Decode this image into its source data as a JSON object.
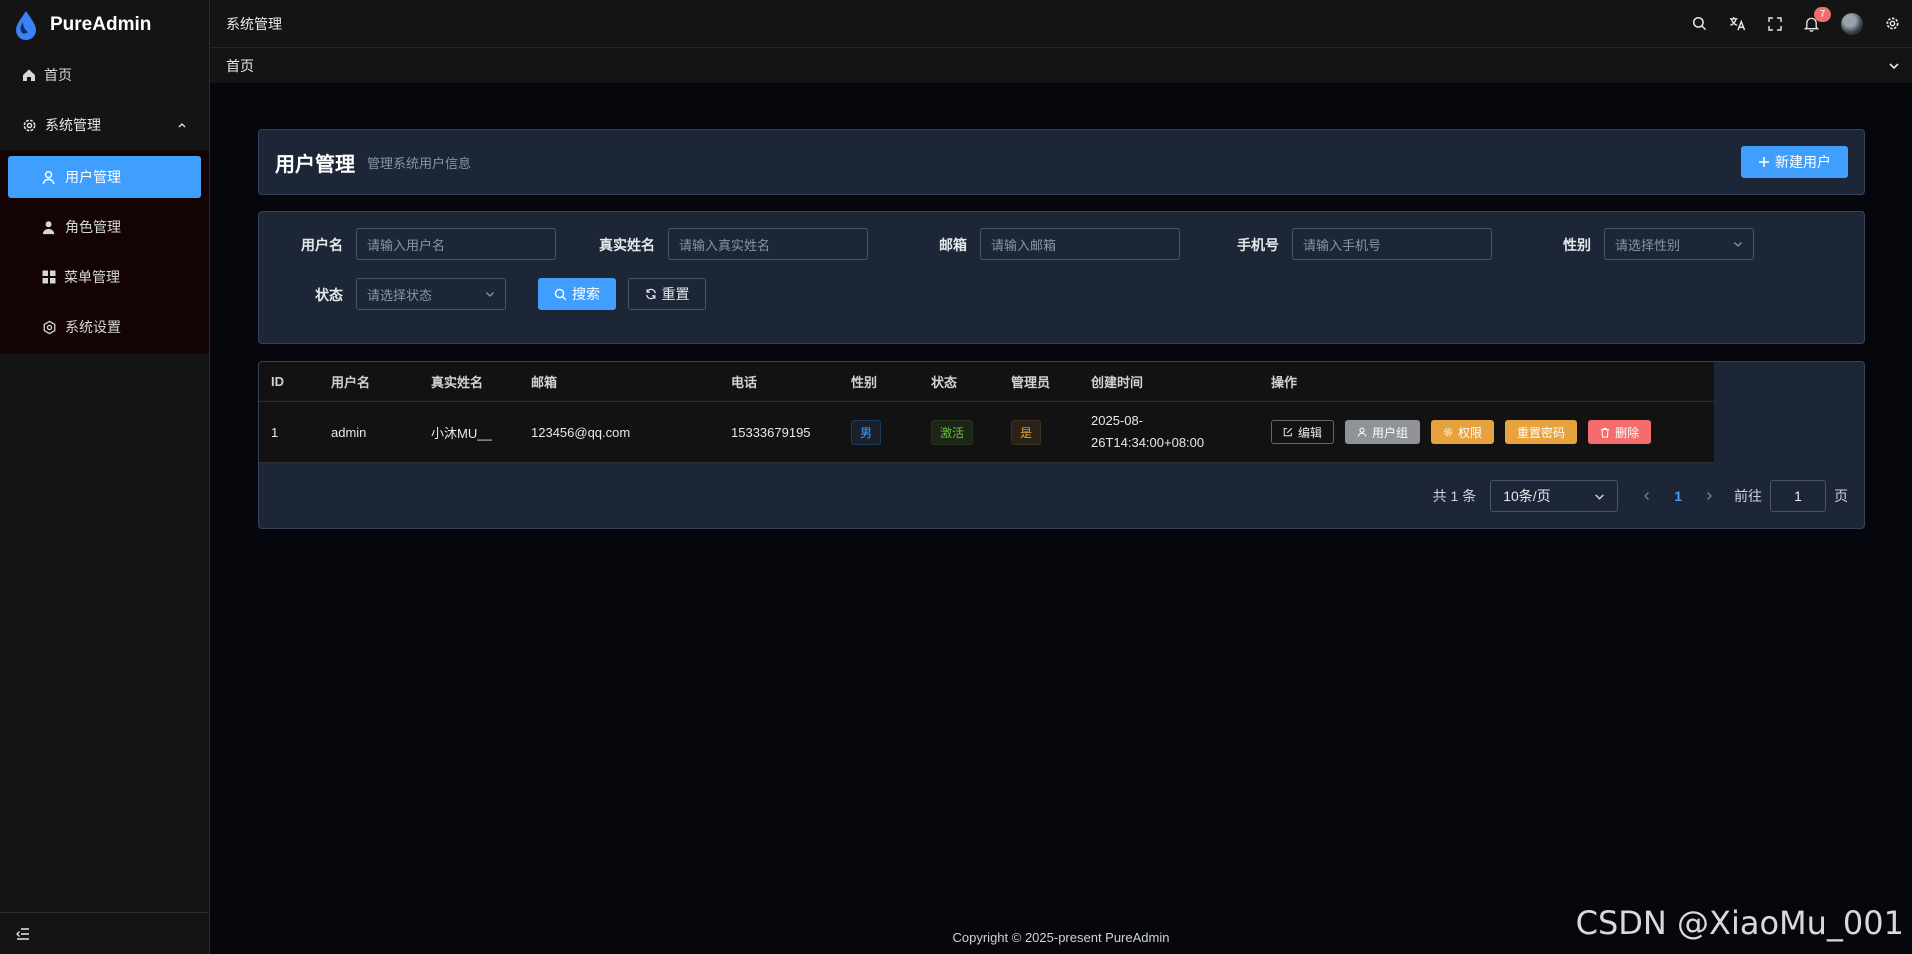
{
  "brand": {
    "name": "PureAdmin"
  },
  "sidebar": {
    "home": "首页",
    "group": "系统管理",
    "items": [
      {
        "label": "用户管理",
        "icon": "user-icon",
        "active": true
      },
      {
        "label": "角色管理",
        "icon": "user-role-icon"
      },
      {
        "label": "菜单管理",
        "icon": "grid-icon"
      },
      {
        "label": "系统设置",
        "icon": "settings-icon"
      }
    ]
  },
  "header": {
    "breadcrumb": "系统管理",
    "notification_count": "7",
    "tab": "首页"
  },
  "page": {
    "title": "用户管理",
    "subtitle": "管理系统用户信息",
    "new_button": "新建用户"
  },
  "filters": {
    "username": {
      "label": "用户名",
      "placeholder": "请输入用户名"
    },
    "realname": {
      "label": "真实姓名",
      "placeholder": "请输入真实姓名"
    },
    "email": {
      "label": "邮箱",
      "placeholder": "请输入邮箱"
    },
    "phone": {
      "label": "手机号",
      "placeholder": "请输入手机号"
    },
    "gender": {
      "label": "性别",
      "placeholder": "请选择性别"
    },
    "status": {
      "label": "状态",
      "placeholder": "请选择状态"
    },
    "search_button": "搜索",
    "reset_button": "重置"
  },
  "table": {
    "columns": [
      "ID",
      "用户名",
      "真实姓名",
      "邮箱",
      "电话",
      "性别",
      "状态",
      "管理员",
      "创建时间",
      "操作"
    ],
    "rows": [
      {
        "id": "1",
        "username": "admin",
        "realname": "小沐MU__",
        "email": "123456@qq.com",
        "phone": "15333679195",
        "gender": "男",
        "status": "激活",
        "admin": "是",
        "created_line1": "2025-08-",
        "created_line2": "26T14:34:00+08:00",
        "actions": {
          "edit": "编辑",
          "group": "用户组",
          "perm": "权限",
          "reset_pwd": "重置密码",
          "delete": "删除"
        }
      }
    ]
  },
  "pagination": {
    "total": "共 1 条",
    "page_size": "10条/页",
    "current": "1",
    "goto_label": "前往",
    "goto_value": "1",
    "unit": "页"
  },
  "footer": {
    "copyright": "Copyright © 2025-present PureAdmin"
  },
  "watermark": "CSDN @XiaoMu_001",
  "colors": {
    "primary": "#409eff",
    "warning": "#e6a23c",
    "danger": "#f56c6c",
    "success": "#67c23a",
    "info": "#909399"
  }
}
